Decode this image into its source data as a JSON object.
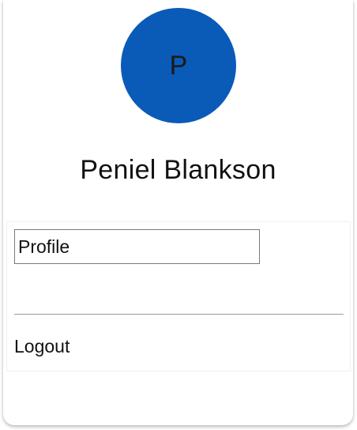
{
  "user": {
    "avatar_initial": "P",
    "name": "Peniel Blankson"
  },
  "menu": {
    "items": [
      {
        "label": "Profile",
        "selected": true
      },
      {
        "label": "Logout",
        "selected": false
      }
    ]
  },
  "colors": {
    "avatar_background": "#0a5bb8",
    "card_background": "#ffffff",
    "text": "#111111"
  }
}
